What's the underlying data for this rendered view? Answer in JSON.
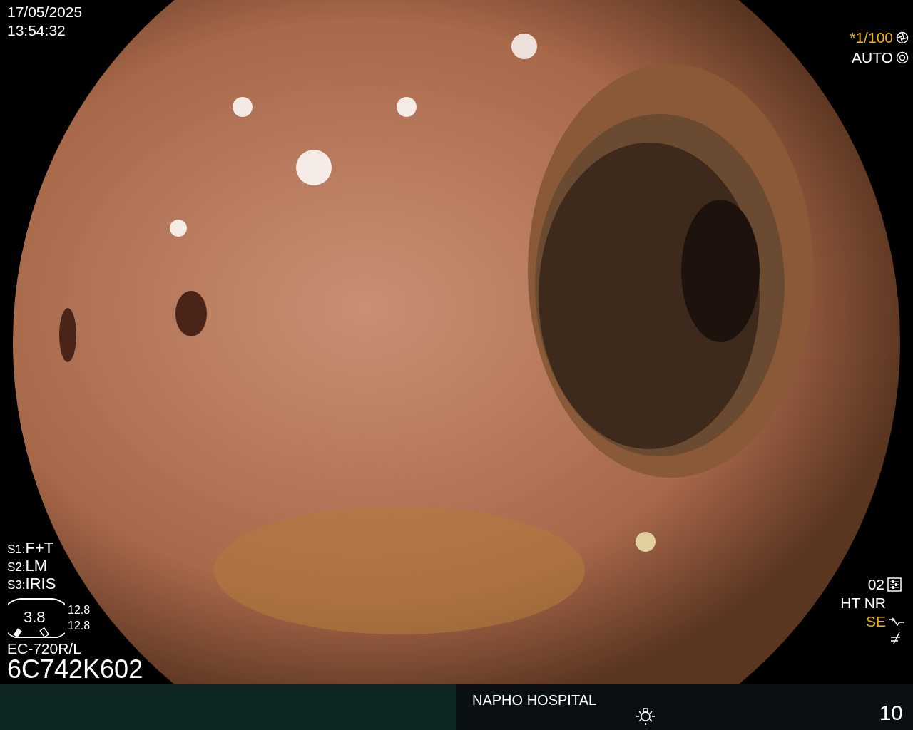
{
  "datetime": {
    "date": "17/05/2025",
    "time": "13:54:32"
  },
  "shutter": {
    "value": "*1/100"
  },
  "exposure": {
    "mode": "AUTO"
  },
  "switches": [
    {
      "label": "S1:",
      "value": "F+T"
    },
    {
      "label": "S2:",
      "value": "LM"
    },
    {
      "label": "S3:",
      "value": "IRIS"
    }
  ],
  "scope_gauge": {
    "value": "3.8",
    "readings": [
      "12.8",
      "12.8"
    ]
  },
  "scope_model": "EC-720R/L",
  "serial": "6C742K602",
  "settings": {
    "preset": "02",
    "modes": [
      "HT",
      "NR"
    ],
    "enhance": "SE"
  },
  "footer": {
    "hospital": "NAPHO HOSPITAL",
    "counter": "10"
  }
}
